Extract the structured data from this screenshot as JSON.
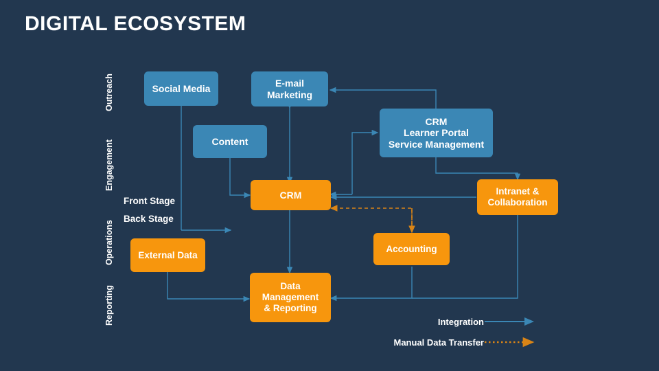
{
  "title": "DIGITAL ECOSYSTEM",
  "colors": {
    "background": "#22374f",
    "blue_node": "#3b87b5",
    "orange_node": "#f7960d",
    "integration_line": "#3b87b5",
    "manual_line": "#d98416",
    "text": "#ffffff"
  },
  "bands": [
    {
      "label": "Outreach"
    },
    {
      "label": "Engagement"
    },
    {
      "label": "Operations"
    },
    {
      "label": "Reporting"
    }
  ],
  "stage_labels": [
    {
      "label": "Front Stage"
    },
    {
      "label": "Back Stage"
    }
  ],
  "nodes": [
    {
      "id": "social-media",
      "label": "Social Media",
      "type": "blue"
    },
    {
      "id": "email-marketing",
      "label": "E-mail\nMarketing",
      "type": "blue"
    },
    {
      "id": "content",
      "label": "Content",
      "type": "blue"
    },
    {
      "id": "crm-learner-portal",
      "label": "CRM\nLearner Portal\nService Management",
      "type": "blue"
    },
    {
      "id": "crm",
      "label": "CRM",
      "type": "orange"
    },
    {
      "id": "intranet-collaboration",
      "label": "Intranet &\nCollaboration",
      "type": "orange"
    },
    {
      "id": "external-data",
      "label": "External Data",
      "type": "orange"
    },
    {
      "id": "accounting",
      "label": "Accounting",
      "type": "orange"
    },
    {
      "id": "data-management-reporting",
      "label": "Data\nManagement\n& Reporting",
      "type": "orange"
    }
  ],
  "legend": [
    {
      "id": "integration",
      "label": "Integration",
      "style": "solid-arrow"
    },
    {
      "id": "manual-data-transfer",
      "label": "Manual Data Transfer",
      "style": "dotted-arrow"
    }
  ]
}
